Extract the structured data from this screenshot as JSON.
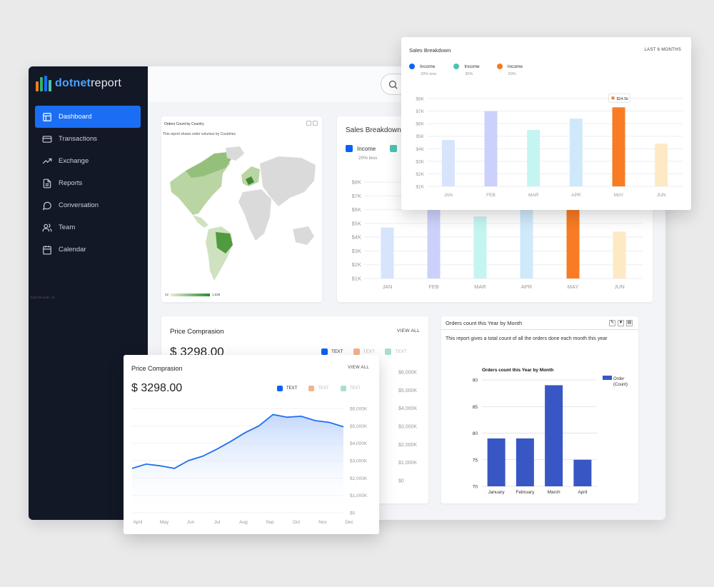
{
  "app": {
    "logo": {
      "part1": "dotnet",
      "part2": "report"
    },
    "nav": [
      {
        "label": "Dashboard",
        "icon": "dashboard-icon",
        "active": true
      },
      {
        "label": "Transactions",
        "icon": "credit-card-icon"
      },
      {
        "label": "Exchange",
        "icon": "trending-up-icon"
      },
      {
        "label": "Reports",
        "icon": "file-text-icon"
      },
      {
        "label": "Conversation",
        "icon": "message-circle-icon"
      },
      {
        "label": "Team",
        "icon": "users-icon"
      },
      {
        "label": "Calendar",
        "icon": "calendar-icon"
      }
    ],
    "search_icon": "search-icon"
  },
  "map_card": {
    "title": "Orders Count by Country",
    "description": "This report shows order volumes by Countries",
    "legend_min": "42",
    "legend_max": "1,028",
    "total": "Total Records: 31"
  },
  "sales_breakdown": {
    "title": "Sales Breakdown",
    "range": "LAST 6 MONTHS",
    "legend": [
      {
        "name": "Income",
        "sub": "20% less",
        "color": "#0b63f6"
      },
      {
        "name": "Income",
        "sub": "30%",
        "color": "#4cc2b0"
      },
      {
        "name": "Income",
        "sub": "50%",
        "color": "#f47a20"
      }
    ],
    "tooltip": "$24.5k"
  },
  "price_comparison": {
    "title": "Price Comprasion",
    "view_all": "VIEW ALL",
    "currency": "$",
    "amount": "3298.00",
    "legend": [
      {
        "name": "TEXT",
        "color": "#0b63f6"
      },
      {
        "name": "TEXT",
        "color": "#f4b28f"
      },
      {
        "name": "TEXT",
        "color": "#a9ddd3"
      }
    ]
  },
  "orders_card": {
    "title": "Orders count this Year by Month",
    "description": "This report gives a total count of all the orders done each month this year",
    "legend_line1": "Order",
    "legend_line2": "(Count)"
  },
  "chart_data": [
    {
      "id": "sales-breakdown",
      "type": "bar",
      "title": "Sales Breakdown",
      "categories": [
        "JAN",
        "FEB",
        "MAR",
        "APR",
        "MAY",
        "JUN"
      ],
      "values": [
        4.7,
        7.0,
        5.5,
        6.4,
        7.3,
        4.4
      ],
      "colors": [
        "#d6e5fb",
        "#ccd1fb",
        "#c4f5f0",
        "#cfe9fb",
        "#f77c24",
        "#fde9c4"
      ],
      "y_ticks": [
        "$1K",
        "$2K",
        "$3K",
        "$4K",
        "$5K",
        "$6K",
        "$7K",
        "$8K"
      ],
      "ylim": [
        1,
        8
      ]
    },
    {
      "id": "price-comparison",
      "type": "area",
      "title": "Price Comprasion",
      "x": [
        "April",
        "May",
        "Jun",
        "Jul",
        "Aug",
        "Sep",
        "Oct",
        "Nov",
        "Dec"
      ],
      "y_ticks": [
        "$0",
        "$1,000K",
        "$2,000K",
        "$3,000K",
        "$4,000K",
        "$5,000K",
        "$6,000K"
      ],
      "ylim": [
        0,
        6000
      ],
      "series": [
        {
          "values": [
            2550,
            2800,
            2700,
            2550,
            3000,
            3250,
            3650,
            4100,
            4600,
            5000,
            5650,
            5500,
            5550,
            5300,
            5200,
            4950
          ]
        }
      ]
    },
    {
      "id": "orders-by-month",
      "type": "bar",
      "title": "Orders count this Year by Month",
      "categories": [
        "January",
        "February",
        "March",
        "April"
      ],
      "series": [
        {
          "name": "Order (Count)",
          "values": [
            79,
            79,
            89,
            75
          ]
        }
      ],
      "y_ticks": [
        "70",
        "75",
        "80",
        "85",
        "90"
      ],
      "ylim": [
        70,
        90
      ],
      "color": "#3957c4"
    }
  ]
}
